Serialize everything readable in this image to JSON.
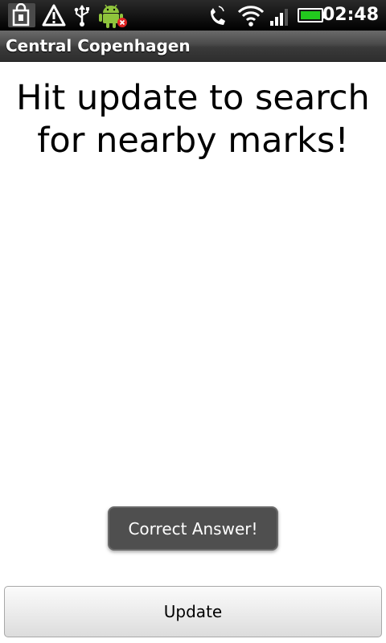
{
  "status_bar": {
    "time": "02:48",
    "icons": [
      "notification-bag-icon",
      "warning-icon",
      "usb-icon",
      "android-debug-icon",
      "phone-icon",
      "wifi-icon",
      "signal-icon",
      "battery-icon"
    ]
  },
  "title_bar": {
    "title": "Central Copenhagen"
  },
  "main": {
    "message_line1": "Hit update to search",
    "message_line2": "for nearby marks!"
  },
  "toast": {
    "text": "Correct Answer!"
  },
  "update_button": {
    "label": "Update"
  },
  "colors": {
    "battery": "#22c81e",
    "android": "#8fc43c",
    "toast_bg": "#4f4f4f"
  }
}
